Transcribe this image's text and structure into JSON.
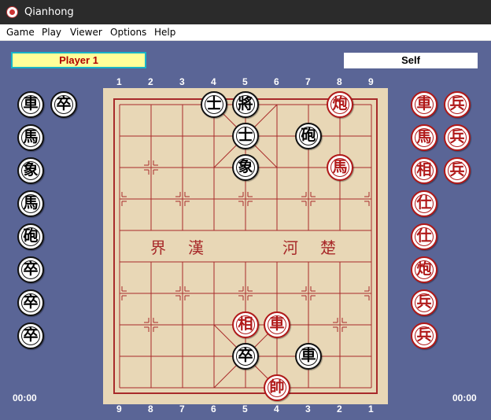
{
  "window": {
    "title": "Qianhong"
  },
  "menu": [
    "Game",
    "Play",
    "Viewer",
    "Options",
    "Help"
  ],
  "panels": {
    "left_player": "Player 1",
    "right_player": "Self"
  },
  "timers": {
    "left": "00:00",
    "right": "00:00"
  },
  "top_files": [
    "1",
    "2",
    "3",
    "4",
    "5",
    "6",
    "7",
    "8",
    "9"
  ],
  "bottom_files": [
    "9",
    "8",
    "7",
    "6",
    "5",
    "4",
    "3",
    "2",
    "1"
  ],
  "river": [
    "界",
    "漢",
    "河",
    "楚"
  ],
  "colors": {
    "background": "#5a6596",
    "board": "#e8d7b6",
    "grid": "#a82a2a",
    "red_piece": "#b01818",
    "black_piece": "#111111"
  },
  "board_pieces": [
    {
      "glyph": "士",
      "color": "black",
      "col": 4,
      "row": 1
    },
    {
      "glyph": "將",
      "color": "black",
      "col": 5,
      "row": 1
    },
    {
      "glyph": "炮",
      "color": "red",
      "col": 8,
      "row": 1
    },
    {
      "glyph": "士",
      "color": "black",
      "col": 5,
      "row": 2
    },
    {
      "glyph": "砲",
      "color": "black",
      "col": 7,
      "row": 2
    },
    {
      "glyph": "象",
      "color": "black",
      "col": 5,
      "row": 3
    },
    {
      "glyph": "馬",
      "color": "red",
      "col": 8,
      "row": 3
    },
    {
      "glyph": "車",
      "color": "red",
      "col": 6,
      "row": 8
    },
    {
      "glyph": "相",
      "color": "red",
      "col": 5,
      "row": 8
    },
    {
      "glyph": "車",
      "color": "black",
      "col": 7,
      "row": 9
    },
    {
      "glyph": "卒",
      "color": "black",
      "col": 5,
      "row": 9
    },
    {
      "glyph": "帥",
      "color": "red",
      "col": 6,
      "row": 10
    }
  ],
  "captured_left": [
    {
      "glyph": "車",
      "color": "black",
      "slot": 1,
      "sub": 0
    },
    {
      "glyph": "卒",
      "color": "black",
      "slot": 1,
      "sub": 1
    },
    {
      "glyph": "馬",
      "color": "black",
      "slot": 2,
      "sub": 0
    },
    {
      "glyph": "象",
      "color": "black",
      "slot": 3,
      "sub": 0
    },
    {
      "glyph": "馬",
      "color": "black",
      "slot": 4,
      "sub": 0
    },
    {
      "glyph": "砲",
      "color": "black",
      "slot": 5,
      "sub": 0
    },
    {
      "glyph": "卒",
      "color": "black",
      "slot": 6,
      "sub": 0
    },
    {
      "glyph": "卒",
      "color": "black",
      "slot": 7,
      "sub": 0
    },
    {
      "glyph": "卒",
      "color": "black",
      "slot": 8,
      "sub": 0
    }
  ],
  "captured_right": [
    {
      "glyph": "車",
      "color": "red",
      "slot": 1,
      "sub": 0
    },
    {
      "glyph": "兵",
      "color": "red",
      "slot": 1,
      "sub": 1
    },
    {
      "glyph": "馬",
      "color": "red",
      "slot": 2,
      "sub": 0
    },
    {
      "glyph": "兵",
      "color": "red",
      "slot": 2,
      "sub": 1
    },
    {
      "glyph": "相",
      "color": "red",
      "slot": 3,
      "sub": 0
    },
    {
      "glyph": "兵",
      "color": "red",
      "slot": 3,
      "sub": 1
    },
    {
      "glyph": "仕",
      "color": "red",
      "slot": 4,
      "sub": 0
    },
    {
      "glyph": "仕",
      "color": "red",
      "slot": 5,
      "sub": 0
    },
    {
      "glyph": "炮",
      "color": "red",
      "slot": 6,
      "sub": 0
    },
    {
      "glyph": "兵",
      "color": "red",
      "slot": 7,
      "sub": 0
    },
    {
      "glyph": "兵",
      "color": "red",
      "slot": 8,
      "sub": 0
    }
  ]
}
